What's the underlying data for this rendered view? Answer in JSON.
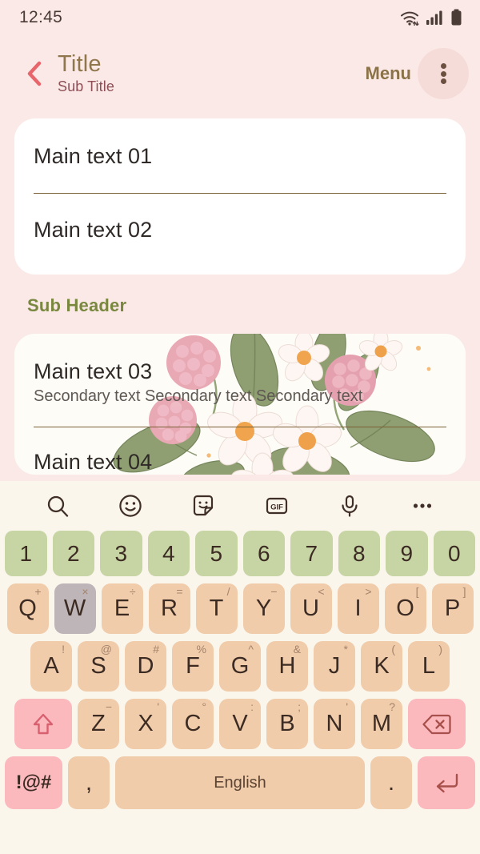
{
  "status_bar": {
    "time": "12:45",
    "icons": [
      "wifi-icon",
      "signal-icon",
      "battery-icon"
    ]
  },
  "app_bar": {
    "back_icon": "back-chevron-icon",
    "title": "Title",
    "subtitle": "Sub Title",
    "menu_label": "Menu",
    "overflow_icon": "overflow-menu-icon"
  },
  "content": {
    "card_one": {
      "rows": [
        {
          "main": "Main text 01"
        },
        {
          "main": "Main text 02"
        }
      ]
    },
    "sub_header": "Sub Header",
    "card_two": {
      "rows": [
        {
          "main": "Main text 03",
          "secondary": "Secondary text Secondary text Secondary text"
        },
        {
          "main": "Main text 04"
        }
      ]
    }
  },
  "keyboard": {
    "toolbar": [
      "search-icon",
      "emoji-icon",
      "sticker-icon",
      "gif-icon",
      "microphone-icon",
      "more-icon"
    ],
    "gif_label": "GIF",
    "rows": {
      "numbers": [
        {
          "label": "1"
        },
        {
          "label": "2"
        },
        {
          "label": "3"
        },
        {
          "label": "4"
        },
        {
          "label": "5"
        },
        {
          "label": "6"
        },
        {
          "label": "7"
        },
        {
          "label": "8"
        },
        {
          "label": "9"
        },
        {
          "label": "0"
        }
      ],
      "top": [
        {
          "label": "Q",
          "sup": "+"
        },
        {
          "label": "W",
          "sup": "×",
          "pressed": true
        },
        {
          "label": "E",
          "sup": "÷"
        },
        {
          "label": "R",
          "sup": "="
        },
        {
          "label": "T",
          "sup": "/"
        },
        {
          "label": "Y",
          "sup": "−"
        },
        {
          "label": "U",
          "sup": "<"
        },
        {
          "label": "I",
          "sup": ">"
        },
        {
          "label": "O",
          "sup": "["
        },
        {
          "label": "P",
          "sup": "]"
        }
      ],
      "home": [
        {
          "label": "A",
          "sup": "!"
        },
        {
          "label": "S",
          "sup": "@"
        },
        {
          "label": "D",
          "sup": "#"
        },
        {
          "label": "F",
          "sup": "%"
        },
        {
          "label": "G",
          "sup": "^"
        },
        {
          "label": "H",
          "sup": "&"
        },
        {
          "label": "J",
          "sup": "*"
        },
        {
          "label": "K",
          "sup": "("
        },
        {
          "label": "L",
          "sup": ")"
        }
      ],
      "bottom_letters": [
        {
          "label": "Z",
          "sup": "−"
        },
        {
          "label": "X",
          "sup": "'"
        },
        {
          "label": "C",
          "sup": "°"
        },
        {
          "label": "V",
          "sup": ":"
        },
        {
          "label": "B",
          "sup": ";"
        },
        {
          "label": "N",
          "sup": "'"
        },
        {
          "label": "M",
          "sup": "?"
        }
      ],
      "shift_icon": "shift-icon",
      "backspace_icon": "backspace-icon",
      "symbols_label": "!@#",
      "comma_label": ",",
      "space_label": "English",
      "period_label": ".",
      "enter_icon": "enter-icon"
    }
  },
  "colors": {
    "page_background": "#fae9e6",
    "card_background": "#ffffff",
    "title": "#90764d",
    "subtitle": "#8e4f57",
    "sub_header": "#79873f",
    "accent_pink": "#fbb9be",
    "key_number": "#c7d5a5",
    "key_letter": "#f0ccab",
    "key_pressed": "#bdb5b8",
    "keyboard_background": "#fbf6ec",
    "divider": "#7a6034"
  }
}
